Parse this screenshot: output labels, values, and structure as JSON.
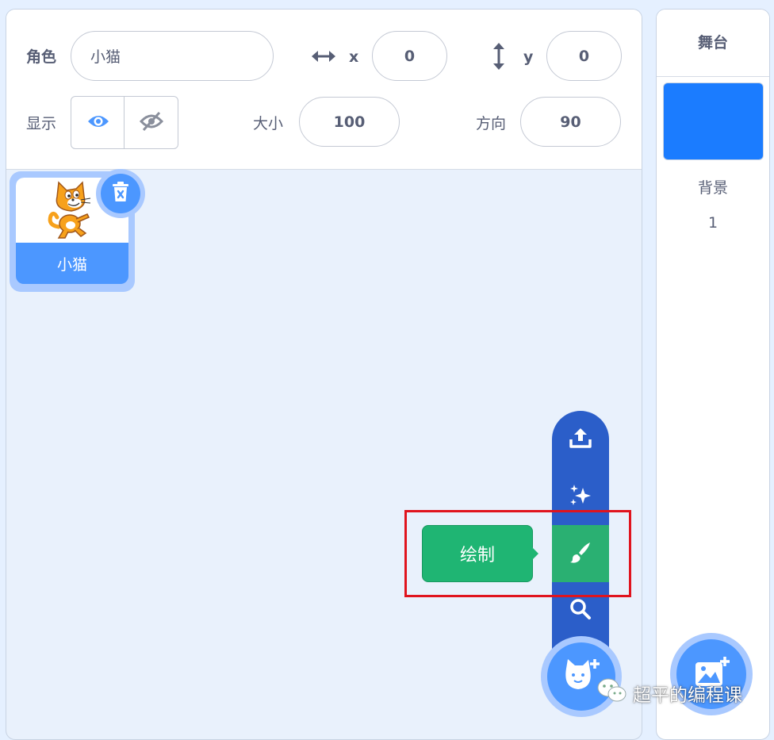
{
  "sprite_info": {
    "sprite_label": "角色",
    "sprite_name_value": "小猫",
    "x_label": "x",
    "x_value": "0",
    "y_label": "y",
    "y_value": "0",
    "show_label": "显示",
    "size_label": "大小",
    "size_value": "100",
    "direction_label": "方向",
    "direction_value": "90"
  },
  "sprite_list": {
    "items": [
      {
        "name": "小猫",
        "selected": true
      }
    ]
  },
  "add_sprite_menu": {
    "items": [
      "upload-icon",
      "surprise-sparkle-icon",
      "paint-brush-icon",
      "search-icon"
    ],
    "tooltip": "绘制",
    "hovered": "paint-brush-icon"
  },
  "stage": {
    "header": "舞台",
    "backdrop_label": "背景",
    "backdrop_count": "1",
    "thumbnail_color": "#1b7cff"
  },
  "watermark": {
    "text": "超平的编程课"
  },
  "colors": {
    "primary": "#4c97ff",
    "menu_blue": "#2b5ec9",
    "paint_green": "#2ab072",
    "highlight_red": "#e0141e",
    "text_gray": "#575e75"
  }
}
